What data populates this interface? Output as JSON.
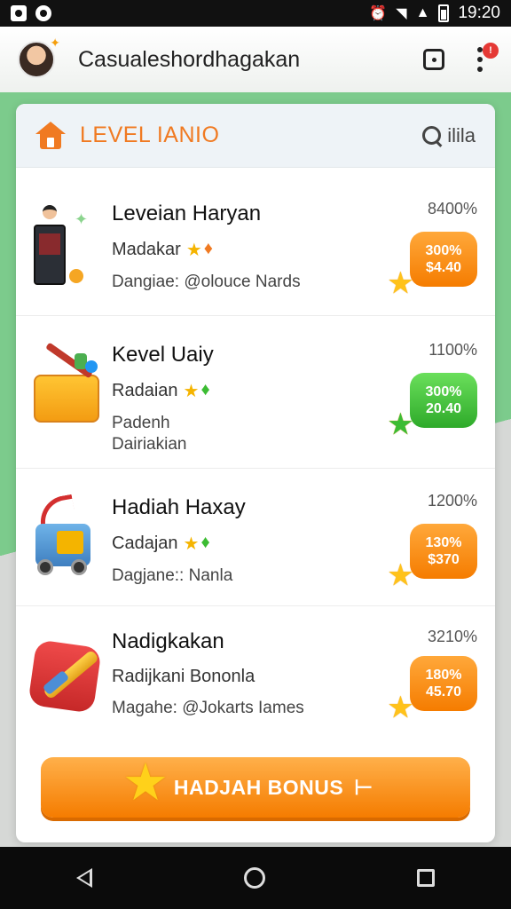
{
  "status_bar": {
    "time": "19:20"
  },
  "app_bar": {
    "title": "Casualeshordhagakan"
  },
  "notification_badge": "!",
  "card": {
    "header_title": "LEVEL IANIO",
    "search_label": "ilila"
  },
  "items": [
    {
      "title": "Leveian Haryan",
      "subtitle": "Madakar",
      "meta": "Dangiae: @olouce Nards",
      "percent": "8400%",
      "bubble_top": "300%",
      "bubble_bottom": "$4.40",
      "bubble_color": "#f57c00"
    },
    {
      "title": "Kevel Uaiy",
      "subtitle": "Radaian",
      "meta": "Padenh\nDairiakian",
      "percent": "1100%",
      "bubble_top": "300%",
      "bubble_bottom": "20.40",
      "bubble_color": "#2eaa2a"
    },
    {
      "title": "Hadiah Haxay",
      "subtitle": "Cadajan",
      "meta": "Dagjane:: Nanla",
      "percent": "1200%",
      "bubble_top": "130%",
      "bubble_bottom": "$370",
      "bubble_color": "#f57c00"
    },
    {
      "title": "Nadigkakan",
      "subtitle": "Radijkani Bononla",
      "meta": "Magahe: @Jokarts Iames",
      "percent": "3210%",
      "bubble_top": "180%",
      "bubble_bottom": "45.70",
      "bubble_color": "#f57c00"
    }
  ],
  "bonus_button": {
    "label": "HADJAH BONUS",
    "arrow": "⊢"
  },
  "icons": {
    "status_left": [
      "notification-icon",
      "media-icon"
    ],
    "status_right": [
      "alarm-icon",
      "wifi-icon",
      "signal-icon",
      "battery-icon"
    ],
    "app_bar": [
      "avatar",
      "square-icon",
      "more-icon"
    ],
    "nav": [
      "back-icon",
      "home-icon",
      "recents-icon"
    ]
  }
}
